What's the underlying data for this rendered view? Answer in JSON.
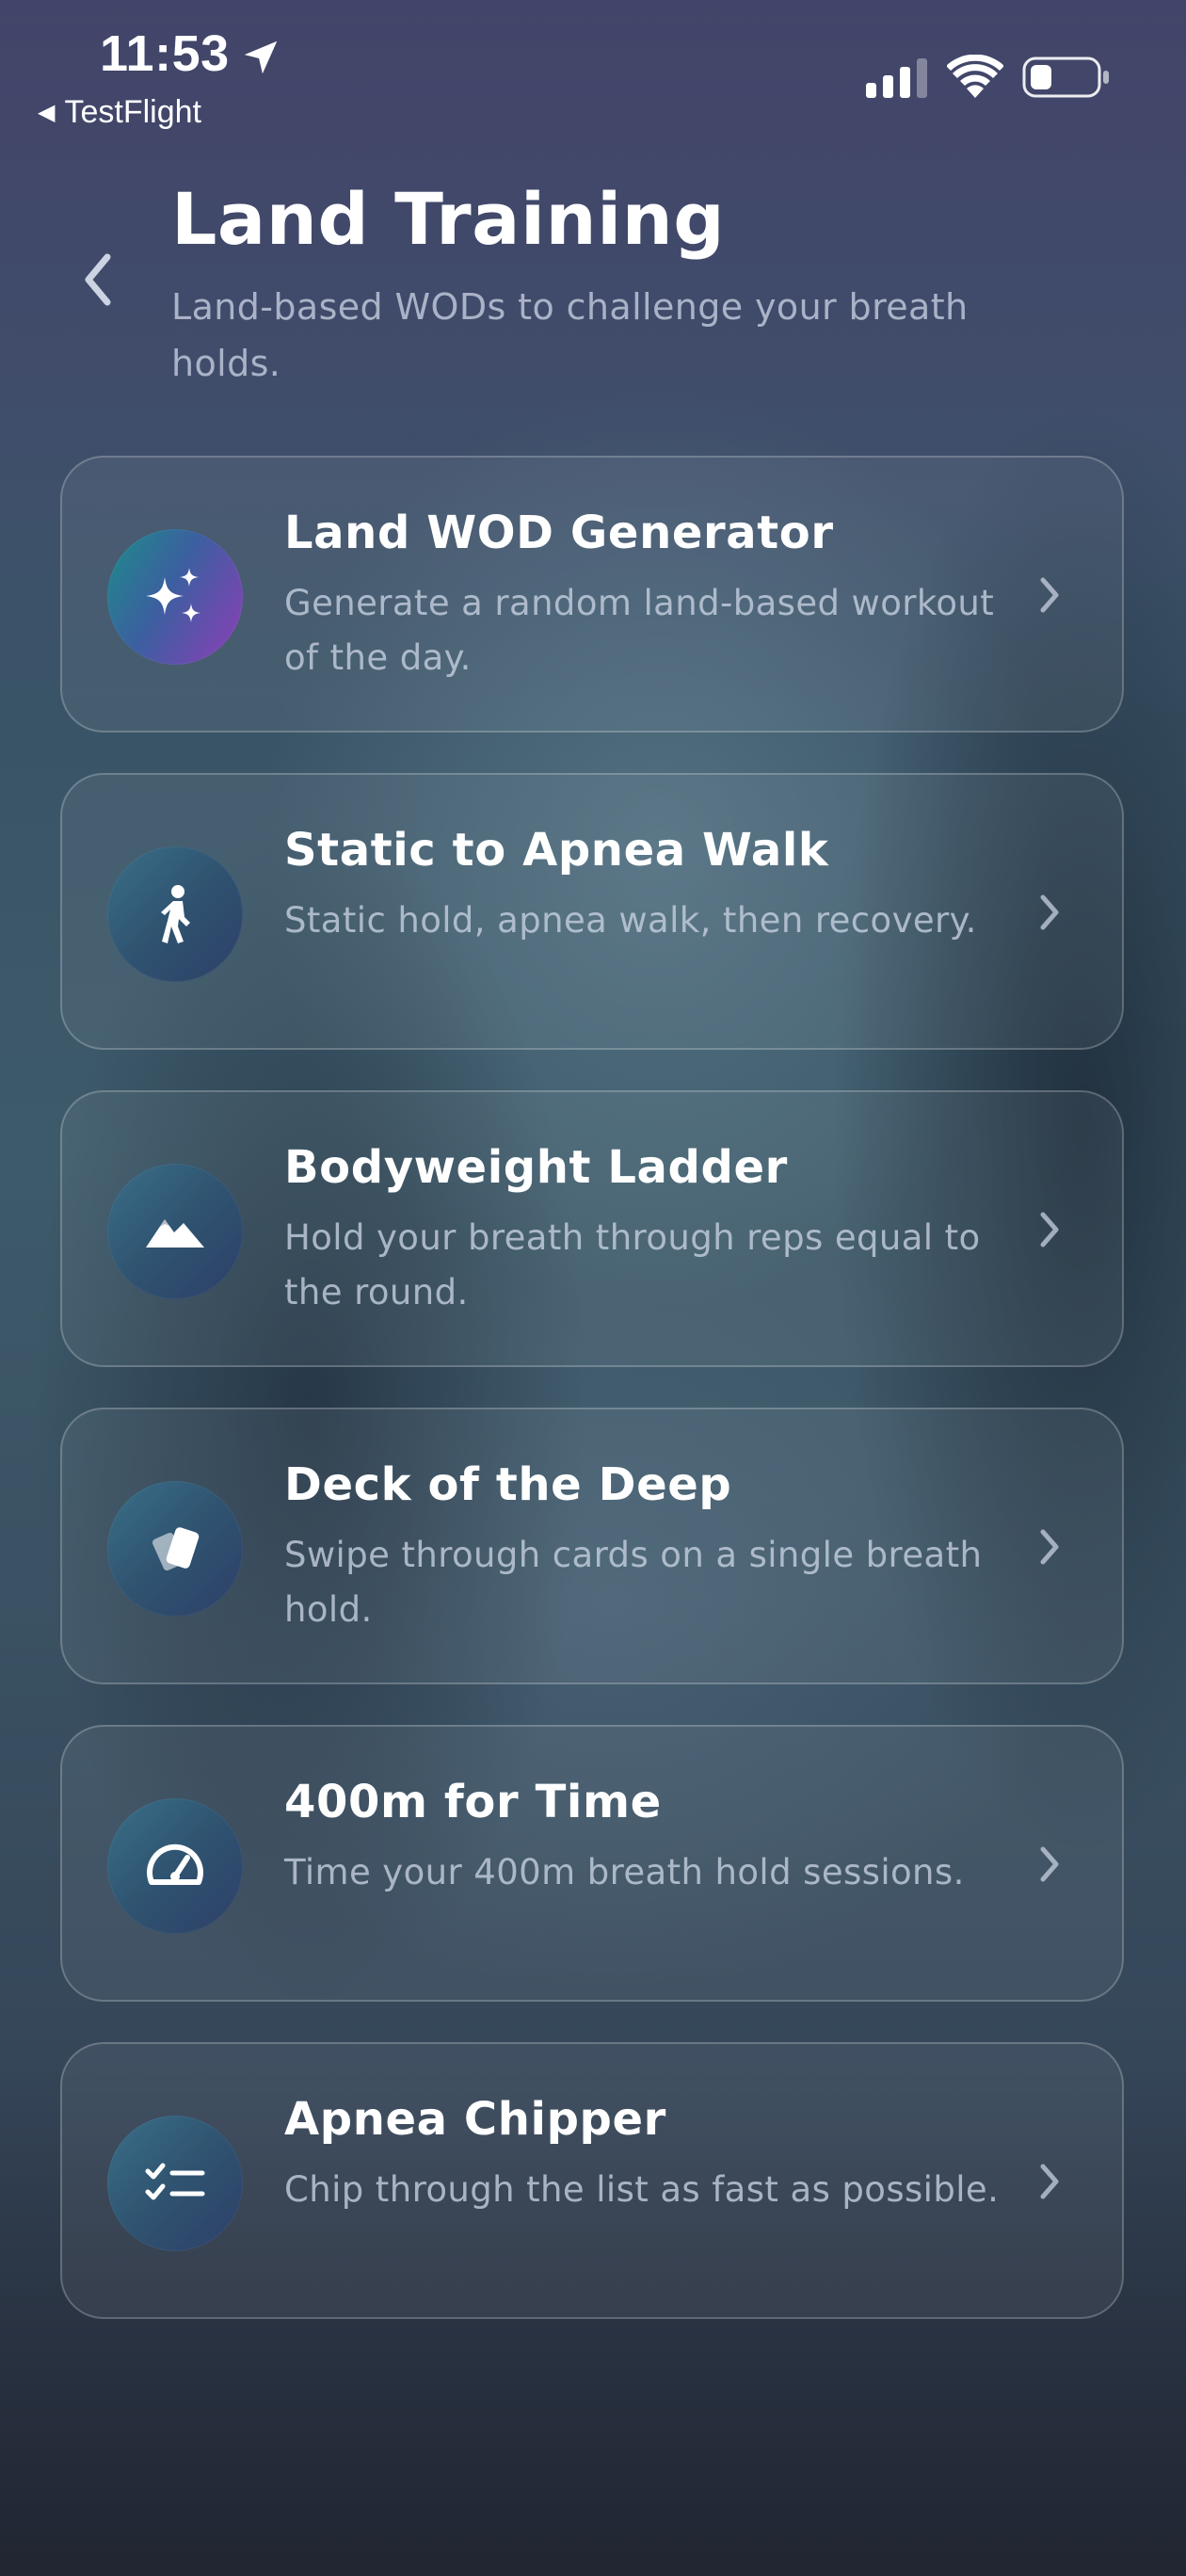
{
  "status_bar": {
    "time": "11:53",
    "back_app_label": "TestFlight",
    "icons": [
      "location-arrow-icon",
      "cellular-signal-icon",
      "wifi-icon",
      "battery-icon"
    ]
  },
  "header": {
    "back_icon": "chevron-left-icon",
    "title": "Land Training",
    "subtitle": "Land-based WODs to challenge your breath holds."
  },
  "cards": [
    {
      "title": "Land WOD Generator",
      "description": "Generate a random land-based workout of the day.",
      "icon": "sparkles-icon"
    },
    {
      "title": "Static to Apnea Walk",
      "description": "Static hold, apnea walk, then recovery.",
      "icon": "walking-person-icon"
    },
    {
      "title": "Bodyweight Ladder",
      "description": "Hold your breath through reps equal to the round.",
      "icon": "mountains-icon"
    },
    {
      "title": "Deck of the Deep",
      "description": "Swipe through cards on a single breath hold.",
      "icon": "cards-icon"
    },
    {
      "title": "400m for Time",
      "description": "Time your 400m breath hold sessions.",
      "icon": "speedometer-icon"
    },
    {
      "title": "Apnea Chipper",
      "description": "Chip through the list as fast as possible.",
      "icon": "checklist-icon"
    }
  ],
  "colors": {
    "generator_icon_gradient": [
      "#1d8c8a",
      "#3c5fa0",
      "#8e3eb8"
    ],
    "standard_icon_gradient": [
      "#3a6f88",
      "#2e3f68"
    ],
    "description_text": "#c8d2e1"
  }
}
